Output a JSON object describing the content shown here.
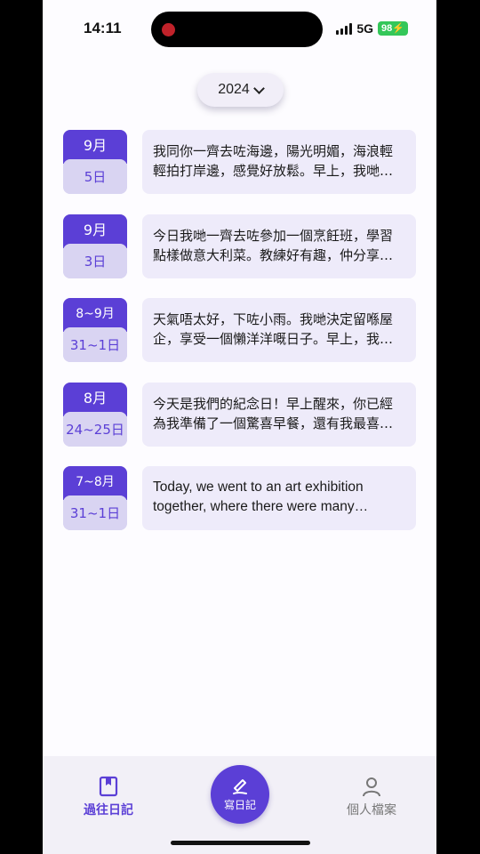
{
  "status_bar": {
    "time": "14:11",
    "network": "5G",
    "battery": "98"
  },
  "year_selector": {
    "label": "2024"
  },
  "entries": [
    {
      "month": "9月",
      "day": "5日",
      "text": "我同你一齊去咗海邊，陽光明媚，海浪輕輕拍打岸邊，感覺好放鬆。早上，我哋一齊沿住沙灘散步，執咗好多貝殼。"
    },
    {
      "month": "9月",
      "day": "3日",
      "text": "今日我哋一齊去咗參加一個烹飪班，學習點樣做意大利菜。教練好有趣，仲分享咗好多小秘訣。"
    },
    {
      "month": "8~9月",
      "day": "31~1日",
      "text": "天氣唔太好，下咗小雨。我哋決定留喺屋企，享受一個懶洋洋嘅日子。早上，我哋一齊睇咗套電影。"
    },
    {
      "month": "8月",
      "day": "24~25日",
      "text": "今天是我們的紀念日！早上醒來，你已經為我準備了一個驚喜早餐，還有我最喜歡的咖啡和鬆餅。"
    },
    {
      "month": "7~8月",
      "day": "31~1日",
      "text": "Today, we went to an art exhibition together, where there were many beautiful paintings and sculptures."
    }
  ],
  "nav": {
    "past_label": "過往日記",
    "write_label": "寫日記",
    "profile_label": "個人檔案"
  }
}
